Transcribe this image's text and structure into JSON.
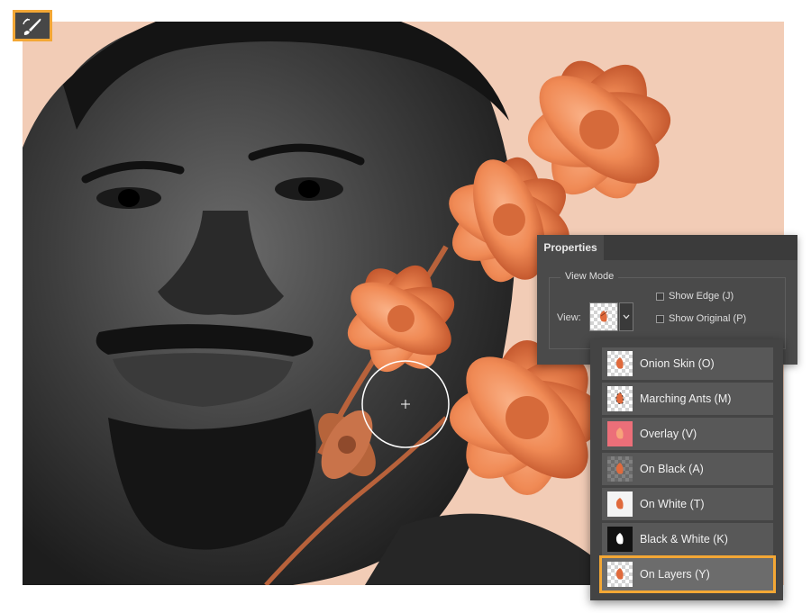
{
  "properties_panel": {
    "tab_label": "Properties",
    "view_mode_group_label": "View Mode",
    "view_label": "View:",
    "show_edge_label": "Show Edge (J)",
    "show_original_label": "Show Original (P)"
  },
  "view_menu": {
    "items": [
      {
        "label": "Onion Skin (O)",
        "thumb": "checker"
      },
      {
        "label": "Marching Ants (M)",
        "thumb": "checker"
      },
      {
        "label": "Overlay (V)",
        "thumb": "overlay"
      },
      {
        "label": "On Black (A)",
        "thumb": "dark"
      },
      {
        "label": "On White (T)",
        "thumb": "white"
      },
      {
        "label": "Black & White (K)",
        "thumb": "black"
      },
      {
        "label": "On Layers (Y)",
        "thumb": "checker",
        "selected": true
      }
    ]
  },
  "tool": {
    "icon": "select-and-mask-brush-icon"
  },
  "colors": {
    "highlight": "#f3a735",
    "panel_bg": "#4a4a4a",
    "background": "#f2ccb6",
    "flower": "#f08a55"
  }
}
